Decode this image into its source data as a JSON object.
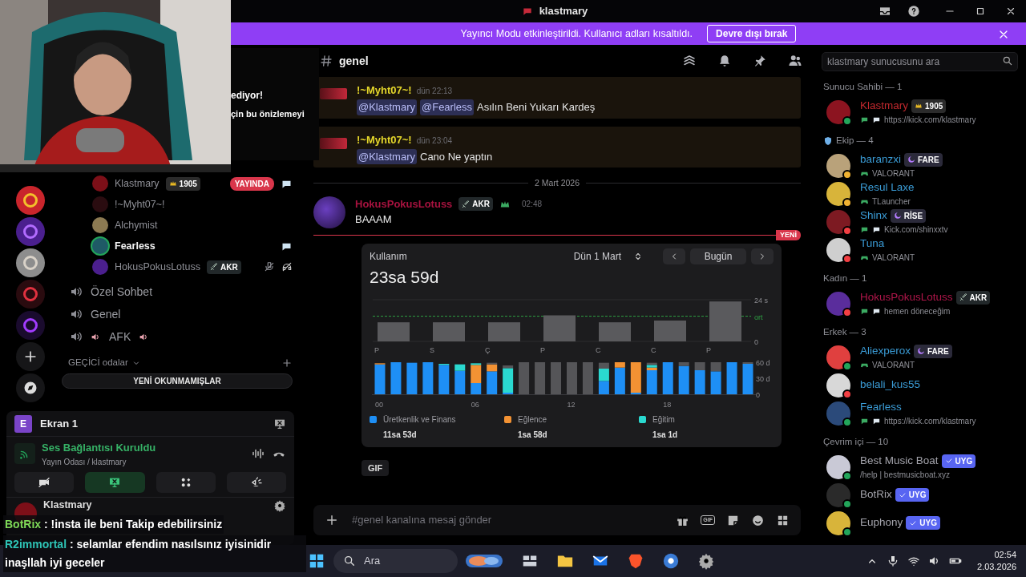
{
  "window": {
    "title": "klastmary"
  },
  "banner": {
    "text": "Yayıncı Modu etkinleştirildi. Kullanıcı adları kısaltıldı.",
    "button": "Devre dışı bırak"
  },
  "popup_fragment": [
    "ediyor!",
    "çin bu önizlemeyi"
  ],
  "voice_users": [
    {
      "name": "Klastmary",
      "badge": {
        "kind": "boost",
        "text": "1905"
      },
      "live": "YAYINDA",
      "speaking": false,
      "activity_icon": true,
      "muted": false
    },
    {
      "name": "!~Myht07~!",
      "speaking": false,
      "activity_icon": false,
      "muted": false
    },
    {
      "name": "Alchymist",
      "speaking": false,
      "activity_icon": false,
      "muted": false
    },
    {
      "name": "Fearless",
      "speaking": true,
      "activity_icon": true,
      "muted": false
    },
    {
      "name": "HokusPokusLotuss",
      "badge": {
        "kind": "tag",
        "text": "AKR"
      },
      "speaking": false,
      "activity_icon": false,
      "muted": true
    }
  ],
  "voice_channels": [
    {
      "name": "Özel Sohbet",
      "emoji": false
    },
    {
      "name": "Genel",
      "emoji": false
    },
    {
      "name": "AFK",
      "emoji": true
    }
  ],
  "category": "GEÇİCİ odalar",
  "unread_button": "YENİ OKUNMAMIŞLAR",
  "stream": {
    "title": "Ekran 1",
    "avatar_letter": "E"
  },
  "voice_status": {
    "title": "Ses Bağlantısı Kuruldu",
    "subtitle": "Yayın Odası / klastmary"
  },
  "user_panel": {
    "name": "Klastmary"
  },
  "channel": {
    "name": "genel"
  },
  "search": {
    "placeholder": "klastmary sunucusunu ara"
  },
  "messages": [
    {
      "author": "!~Myht07~!",
      "time": "dün 22:13",
      "mentions": [
        "@Klastmary",
        "@Fearless"
      ],
      "text": "Asılın Beni Yukarı Kardeş",
      "highlighted": true
    },
    {
      "author": "!~Myht07~!",
      "time": "dün 23:04",
      "mentions": [
        "@Klastmary"
      ],
      "text": "Cano Ne yaptın",
      "highlighted": true
    }
  ],
  "date_divider": "2 Mart 2026",
  "post": {
    "author": "HokusPokusLotuss",
    "tag": "AKR",
    "time": "02:48",
    "text": "BAAAM"
  },
  "new_marker": "YENİ",
  "usage": {
    "title": "Kullanım",
    "date": "Dün 1 Mart",
    "today": "Bugün",
    "total": "23sa 59d",
    "weekly": {
      "chart_data": {
        "type": "bar",
        "categories": [
          "P",
          "S",
          "Ç",
          "P",
          "C",
          "C",
          "P"
        ],
        "values": [
          11,
          11,
          11,
          15,
          11,
          12,
          23
        ],
        "ylim": [
          0,
          24
        ],
        "yticks": [
          0,
          {
            "value": 14.5,
            "label": "ort"
          },
          {
            "value": 24,
            "label": "24 s"
          }
        ],
        "ref_lines": [
          {
            "axis": "y",
            "value": 14.5
          }
        ]
      }
    },
    "hourly": {
      "chart_data": {
        "type": "bar",
        "stacked": true,
        "x": [
          0,
          1,
          2,
          3,
          4,
          5,
          6,
          7,
          8,
          9,
          10,
          11,
          12,
          13,
          14,
          15,
          16,
          17,
          18,
          19,
          20,
          21,
          22,
          23
        ],
        "xlim": [
          -0.5,
          23.5
        ],
        "xticks": [
          {
            "value": 0,
            "label": "00"
          },
          {
            "value": 6,
            "label": "06"
          },
          {
            "value": 12,
            "label": "12"
          },
          {
            "value": 18,
            "label": "18"
          }
        ],
        "ylim": [
          0,
          60
        ],
        "yticks": [
          0,
          {
            "value": 30,
            "label": "30 d"
          },
          {
            "value": 60,
            "label": "60 d"
          }
        ],
        "series": [
          {
            "name": "Üretkenlik ve Finans",
            "color": "#1e8ff5",
            "values": [
              56,
              60,
              59,
              60,
              55,
              44,
              21,
              43,
              3,
              0,
              0,
              0,
              0,
              0,
              25,
              50,
              3,
              45,
              60,
              53,
              45,
              43,
              60,
              57
            ]
          },
          {
            "name": "Eğlence",
            "color": "#f39233",
            "values": [
              2,
              0,
              0,
              0,
              0,
              0,
              34,
              13,
              0,
              0,
              0,
              0,
              0,
              0,
              0,
              10,
              57,
              5,
              0,
              0,
              0,
              0,
              0,
              0
            ]
          },
          {
            "name": "Eğitim",
            "color": "#2ad9d0",
            "values": [
              0,
              0,
              0,
              0,
              2,
              12,
              3,
              0,
              46,
              0,
              0,
              0,
              0,
              0,
              23,
              0,
              0,
              5,
              0,
              0,
              0,
              0,
              0,
              0
            ]
          },
          {
            "color": "#555558",
            "values": [
              0,
              0,
              null,
              0,
              null,
              null,
              0,
              3,
              5,
              60,
              60,
              60,
              60,
              60,
              11,
              0,
              0,
              4,
              0,
              7,
              15,
              17,
              0,
              3
            ]
          }
        ]
      }
    },
    "legend_totals": [
      "11sa 53d",
      "1sa 58d",
      "1sa 1d"
    ]
  },
  "gif_button": "GIF",
  "composer": {
    "placeholder": "#genel kanalına mesaj gönder",
    "gif": "GIF"
  },
  "member_groups": [
    {
      "title": "Sunucu Sahibi — 1",
      "shield": false,
      "members": [
        {
          "name": "Klastmary",
          "color": "#c0282d",
          "status": {
            "color": "#23a55a"
          },
          "badge": {
            "kind": "boost",
            "text": "1905"
          },
          "sub": {
            "kind": "custom",
            "text": "https://kick.com/klastmary"
          }
        }
      ]
    },
    {
      "title": "Ekip — 4",
      "shield": true,
      "members": [
        {
          "name": "baranzxi",
          "color": "#3a9bd5",
          "status": {
            "color": "#f0b232"
          },
          "badge": {
            "kind": "guild",
            "text": "FARE"
          },
          "sub": {
            "kind": "game",
            "text": "VALORANT"
          }
        },
        {
          "name": "Resul Laxe",
          "color": "#3a9bd5",
          "status": {
            "color": "#f0b232"
          },
          "sub": {
            "kind": "game",
            "text": "TLauncher"
          }
        },
        {
          "name": "Shinx",
          "color": "#3a9bd5",
          "status": {
            "color": "#f23f43"
          },
          "badge": {
            "kind": "guild",
            "text": "RİSE"
          },
          "sub": {
            "kind": "custom",
            "text": "Kick.com/shinxxtv"
          }
        },
        {
          "name": "Tuna",
          "color": "#3a9bd5",
          "status": {
            "color": "#f23f43"
          },
          "sub": {
            "kind": "game",
            "text": "VALORANT"
          }
        }
      ]
    },
    {
      "title": "Kadın — 1",
      "shield": false,
      "members": [
        {
          "name": "HokusPokusLotuss",
          "color": "#b0164a",
          "status": {
            "color": "#f23f43"
          },
          "badge": {
            "kind": "tag",
            "text": "AKR"
          },
          "sub": {
            "kind": "custom",
            "text": "hemen döneceğim"
          }
        }
      ]
    },
    {
      "title": "Erkek — 3",
      "shield": false,
      "members": [
        {
          "name": "Aliexperox",
          "color": "#3a9bd5",
          "status": {
            "color": "#23a55a"
          },
          "badge": {
            "kind": "guild",
            "text": "FARE"
          },
          "sub": {
            "kind": "game",
            "text": "VALORANT"
          }
        },
        {
          "name": "belali_kus55",
          "color": "#3a9bd5",
          "status": {
            "color": "#f23f43"
          }
        },
        {
          "name": "Fearless",
          "color": "#3a9bd5",
          "status": {
            "color": "#23a55a"
          },
          "sub": {
            "kind": "custom",
            "text": "https://kick.com/klastmary"
          }
        }
      ]
    },
    {
      "title": "Çevrim içi — 10",
      "shield": false,
      "members": [
        {
          "name": "Best Music Boat",
          "color": "#a3a3ab",
          "status": {
            "color": "#23a55a"
          },
          "badge": {
            "kind": "app",
            "text": "UYG"
          },
          "sub": {
            "kind": "plain",
            "text": "/help | bestmusicboat.xyz"
          }
        },
        {
          "name": "BotRix",
          "color": "#a3a3ab",
          "status": {
            "color": "#23a55a"
          },
          "badge": {
            "kind": "app",
            "text": "UYG"
          }
        },
        {
          "name": "Euphony",
          "color": "#a3a3ab",
          "status": {
            "color": "#23a55a"
          },
          "badge": {
            "kind": "app",
            "text": "UYG"
          }
        }
      ]
    }
  ],
  "stream_chat": [
    {
      "user": "BotRix",
      "color": "#7ed957",
      "text": ": !insta ile beni Takip edebilirsiniz"
    },
    {
      "user": "R2immortal",
      "color": "#2ec4b6",
      "text": ": selamlar efendim nasılsınız iyisinidir inaşllah iyi geceler"
    }
  ],
  "taskbar": {
    "search": "Ara",
    "time": "02:54",
    "date": "2.03.2026"
  }
}
